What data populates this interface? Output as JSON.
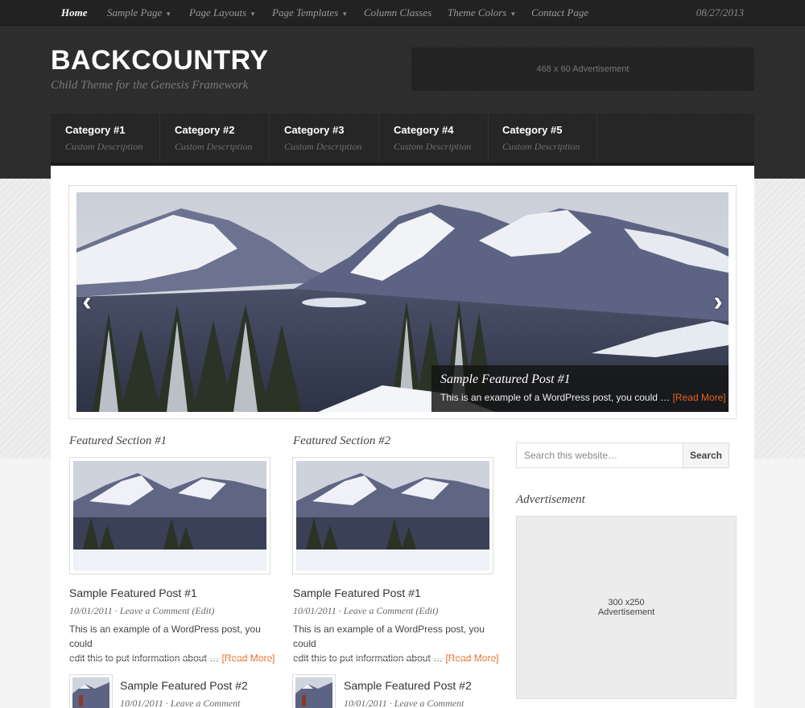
{
  "topnav": {
    "items": [
      {
        "label": "Home",
        "dropdown": false,
        "active": true
      },
      {
        "label": "Sample Page",
        "dropdown": true
      },
      {
        "label": "Page Layouts",
        "dropdown": true
      },
      {
        "label": "Page Templates",
        "dropdown": true
      },
      {
        "label": "Column Classes",
        "dropdown": false
      },
      {
        "label": "Theme Colors",
        "dropdown": true
      },
      {
        "label": "Contact Page",
        "dropdown": false
      }
    ],
    "date": "08/27/2013"
  },
  "header": {
    "title": "BACKCOUNTRY",
    "description": "Child Theme for the Genesis Framework",
    "ad": "468 x 60 Advertisement"
  },
  "categories": [
    {
      "title": "Category #1",
      "desc": "Custom Description"
    },
    {
      "title": "Category #2",
      "desc": "Custom Description"
    },
    {
      "title": "Category #3",
      "desc": "Custom Description"
    },
    {
      "title": "Category #4",
      "desc": "Custom Description"
    },
    {
      "title": "Category #5",
      "desc": "Custom Description"
    }
  ],
  "slider": {
    "caption_title": "Sample Featured Post #1",
    "caption_text": "This is an example of a WordPress post, you could …",
    "caption_more": "[Read More]"
  },
  "featured": [
    {
      "section_title": "Featured Section #1",
      "post1": {
        "title": "Sample Featured Post #1",
        "meta": "10/01/2011 · Leave a Comment (Edit)",
        "excerpt_line1": "This is an example of a WordPress post, you could",
        "excerpt_line2": "edit this to put information about …",
        "more": "[Read More]"
      },
      "post2": {
        "title": "Sample Featured Post #2",
        "meta": "10/01/2011 · Leave a Comment"
      }
    },
    {
      "section_title": "Featured Section #2",
      "post1": {
        "title": "Sample Featured Post #1",
        "meta": "10/01/2011 · Leave a Comment (Edit)",
        "excerpt_line1": "This is an example of a WordPress post, you could",
        "excerpt_line2": "edit this to put information about …",
        "more": "[Read More]"
      },
      "post2": {
        "title": "Sample Featured Post #2",
        "meta": "10/01/2011 · Leave a Comment"
      }
    }
  ],
  "sidebar": {
    "search_placeholder": "Search this website…",
    "search_button": "Search",
    "widget_title": "Advertisement",
    "ad_line1": "300 x250",
    "ad_line2": "Advertisement"
  },
  "colors": {
    "accent": "#e8661a",
    "header_bg": "#2c2c2c",
    "nav_bg": "#222222"
  }
}
